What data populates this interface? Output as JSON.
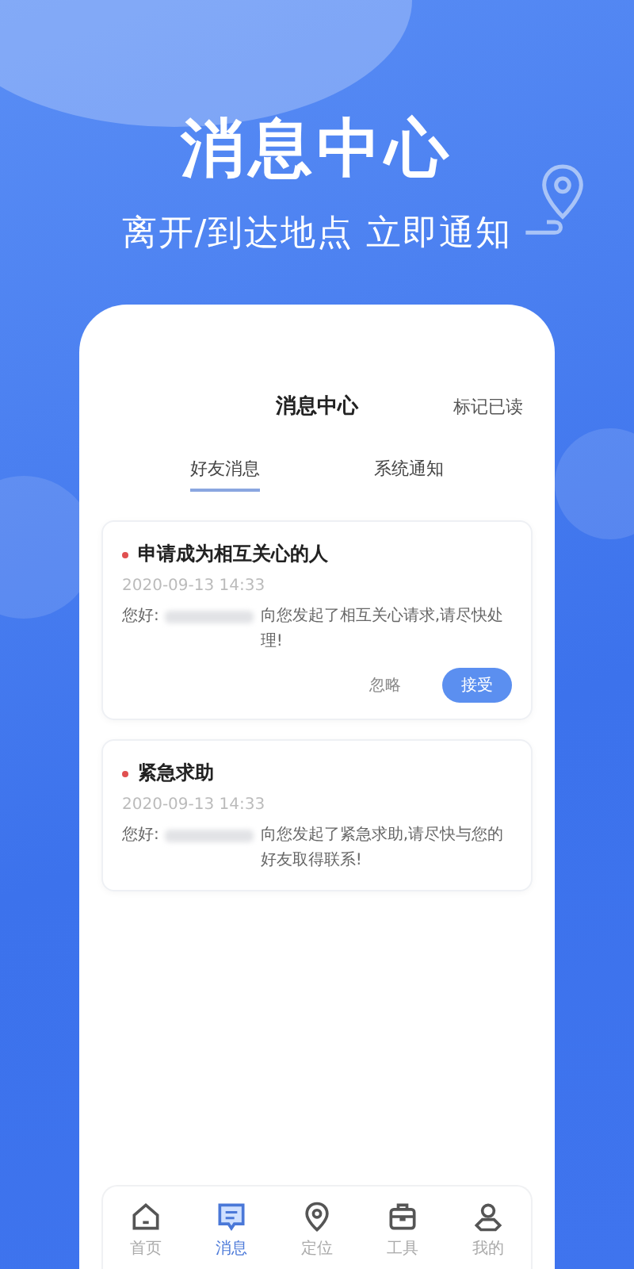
{
  "headline": "消息中心",
  "subtitle": "离开/到达地点 立即通知",
  "screen": {
    "title": "消息中心",
    "action": "标记已读",
    "tabs": [
      {
        "label": "好友消息",
        "selected": true
      },
      {
        "label": "系统通知",
        "selected": false
      }
    ],
    "messages": [
      {
        "title": "申请成为相互关心的人",
        "time": "2020-09-13 14:33",
        "greeting": "您好:",
        "body": "向您发起了相互关心请求,请尽快处理!",
        "buttons": [
          {
            "label": "忽略",
            "kind": "plain"
          },
          {
            "label": "接受",
            "kind": "primary"
          }
        ]
      },
      {
        "title": "紧急求助",
        "time": "2020-09-13 14:33",
        "greeting": "您好:",
        "body": "向您发起了紧急求助,请尽快与您的好友取得联系!"
      }
    ],
    "nav": [
      {
        "label": "首页",
        "selected": false
      },
      {
        "label": "消息",
        "selected": true
      },
      {
        "label": "定位",
        "selected": false
      },
      {
        "label": "工具",
        "selected": false
      },
      {
        "label": "我的",
        "selected": false
      }
    ]
  }
}
